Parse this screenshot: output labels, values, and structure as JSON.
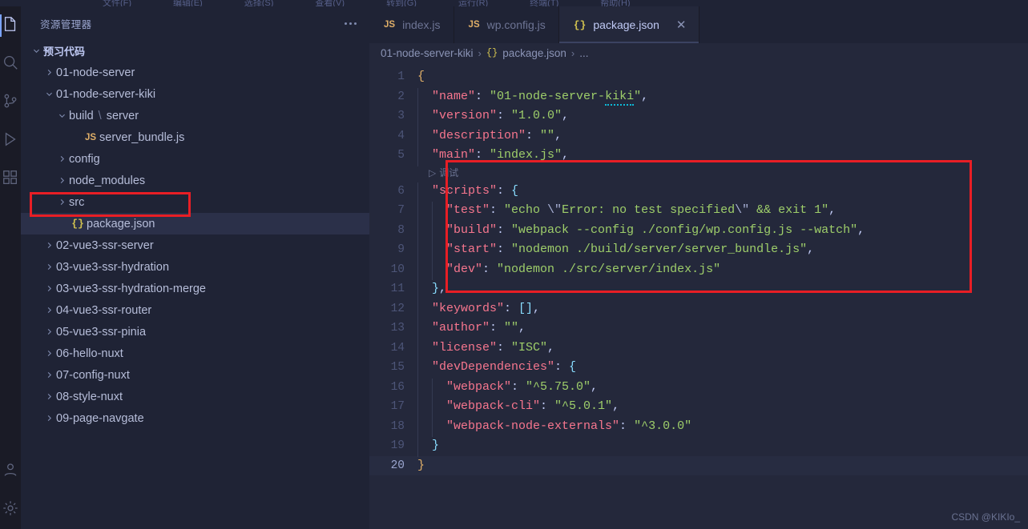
{
  "window": {
    "menu_items": [
      "文件(F)",
      "编辑(E)",
      "选择(S)",
      "查看(V)",
      "转到(G)",
      "运行(R)",
      "终端(T)",
      "帮助(H)"
    ]
  },
  "activitybar": {
    "items": [
      {
        "name": "explorer",
        "icon": "files-icon",
        "active": true
      },
      {
        "name": "search",
        "icon": "search-icon",
        "active": false
      },
      {
        "name": "source-control",
        "icon": "source-control-icon",
        "active": false
      },
      {
        "name": "run-and-debug",
        "icon": "run-debug-icon",
        "active": false
      },
      {
        "name": "extensions",
        "icon": "extensions-icon",
        "active": false
      },
      {
        "name": "accounts",
        "icon": "account-icon",
        "active": false
      },
      {
        "name": "settings",
        "icon": "gear-icon",
        "active": false
      }
    ]
  },
  "sidebar": {
    "title": "资源管理器",
    "more_actions": "more-actions",
    "tree": [
      {
        "label": "预习代码",
        "indent": 0,
        "type": "root",
        "expanded": true,
        "chevron": "down"
      },
      {
        "label": "01-node-server",
        "indent": 1,
        "type": "folder",
        "chevron": "right"
      },
      {
        "label": "01-node-server-kiki",
        "indent": 1,
        "type": "folder",
        "chevron": "down"
      },
      {
        "label": "build",
        "label2": "server",
        "indent": 2,
        "type": "folder",
        "chevron": "down"
      },
      {
        "label": "server_bundle.js",
        "indent": 3,
        "type": "file-js",
        "chevron": "none"
      },
      {
        "label": "config",
        "indent": 2,
        "type": "folder",
        "chevron": "right"
      },
      {
        "label": "node_modules",
        "indent": 2,
        "type": "folder",
        "chevron": "right"
      },
      {
        "label": "src",
        "indent": 2,
        "type": "folder",
        "chevron": "right"
      },
      {
        "label": "package.json",
        "indent": 2,
        "type": "file-json",
        "chevron": "none",
        "selected": true,
        "highlighted": true
      },
      {
        "label": "02-vue3-ssr-server",
        "indent": 1,
        "type": "folder",
        "chevron": "right"
      },
      {
        "label": "03-vue3-ssr-hydration",
        "indent": 1,
        "type": "folder",
        "chevron": "right"
      },
      {
        "label": "03-vue3-ssr-hydration-merge",
        "indent": 1,
        "type": "folder",
        "chevron": "right"
      },
      {
        "label": "04-vue3-ssr-router",
        "indent": 1,
        "type": "folder",
        "chevron": "right"
      },
      {
        "label": "05-vue3-ssr-pinia",
        "indent": 1,
        "type": "folder",
        "chevron": "right"
      },
      {
        "label": "06-hello-nuxt",
        "indent": 1,
        "type": "folder",
        "chevron": "right"
      },
      {
        "label": "07-config-nuxt",
        "indent": 1,
        "type": "folder",
        "chevron": "right"
      },
      {
        "label": "08-style-nuxt",
        "indent": 1,
        "type": "folder",
        "chevron": "right"
      },
      {
        "label": "09-page-navgate",
        "indent": 1,
        "type": "folder",
        "chevron": "right"
      }
    ]
  },
  "editor": {
    "tabs": [
      {
        "label": "index.js",
        "icon": "js",
        "icon_text": "JS",
        "active": false,
        "closable": false
      },
      {
        "label": "wp.config.js",
        "icon": "js",
        "icon_text": "JS",
        "active": false,
        "closable": false
      },
      {
        "label": "package.json",
        "icon": "json",
        "icon_text": "{}",
        "active": true,
        "closable": true,
        "close_label": "✕"
      }
    ],
    "breadcrumb": [
      {
        "text": "01-node-server-kiki",
        "icon": null
      },
      {
        "text": "package.json",
        "icon": "{}"
      },
      {
        "text": "...",
        "icon": null
      }
    ],
    "breadcrumb_separator": "›",
    "codelens": {
      "label": "调试",
      "icon": "▷",
      "line_before": 6
    },
    "current_line": 20,
    "lines": [
      {
        "n": 1,
        "tokens": [
          {
            "t": "{",
            "c": "b1"
          }
        ]
      },
      {
        "n": 2,
        "indent": 1,
        "tokens": [
          {
            "t": "\"name\"",
            "c": "k"
          },
          {
            "t": ": ",
            "c": "b2"
          },
          {
            "t": "\"01-node-server-",
            "c": "s"
          },
          {
            "t": "kiki",
            "c": "s squig"
          },
          {
            "t": "\"",
            "c": "s"
          },
          {
            "t": ",",
            "c": "b2"
          }
        ]
      },
      {
        "n": 3,
        "indent": 1,
        "tokens": [
          {
            "t": "\"version\"",
            "c": "k"
          },
          {
            "t": ": ",
            "c": "b2"
          },
          {
            "t": "\"1.0.0\"",
            "c": "s"
          },
          {
            "t": ",",
            "c": "b2"
          }
        ]
      },
      {
        "n": 4,
        "indent": 1,
        "tokens": [
          {
            "t": "\"description\"",
            "c": "k"
          },
          {
            "t": ": ",
            "c": "b2"
          },
          {
            "t": "\"\"",
            "c": "s"
          },
          {
            "t": ",",
            "c": "b2"
          }
        ]
      },
      {
        "n": 5,
        "indent": 1,
        "tokens": [
          {
            "t": "\"main\"",
            "c": "k"
          },
          {
            "t": ": ",
            "c": "b2"
          },
          {
            "t": "\"index.js\"",
            "c": "s"
          },
          {
            "t": ",",
            "c": "b2"
          }
        ]
      },
      {
        "n": 6,
        "indent": 1,
        "tokens": [
          {
            "t": "\"scripts\"",
            "c": "k"
          },
          {
            "t": ": ",
            "c": "b2"
          },
          {
            "t": "{",
            "c": "p"
          }
        ]
      },
      {
        "n": 7,
        "indent": 2,
        "tokens": [
          {
            "t": "\"test\"",
            "c": "k"
          },
          {
            "t": ": ",
            "c": "b2"
          },
          {
            "t": "\"echo ",
            "c": "s"
          },
          {
            "t": "\\\"",
            "c": "esc"
          },
          {
            "t": "Error: no test specified",
            "c": "s"
          },
          {
            "t": "\\\"",
            "c": "esc"
          },
          {
            "t": " && exit 1\"",
            "c": "s"
          },
          {
            "t": ",",
            "c": "b2"
          }
        ]
      },
      {
        "n": 8,
        "indent": 2,
        "tokens": [
          {
            "t": "\"build\"",
            "c": "k"
          },
          {
            "t": ": ",
            "c": "b2"
          },
          {
            "t": "\"webpack --config ./config/wp.config.js --watch\"",
            "c": "s"
          },
          {
            "t": ",",
            "c": "b2"
          }
        ]
      },
      {
        "n": 9,
        "indent": 2,
        "tokens": [
          {
            "t": "\"start\"",
            "c": "k"
          },
          {
            "t": ": ",
            "c": "b2"
          },
          {
            "t": "\"nodemon ./build/server/server_bundle.js\"",
            "c": "s"
          },
          {
            "t": ",",
            "c": "b2"
          }
        ]
      },
      {
        "n": 10,
        "indent": 2,
        "tokens": [
          {
            "t": "\"dev\"",
            "c": "k"
          },
          {
            "t": ": ",
            "c": "b2"
          },
          {
            "t": "\"nodemon ./src/server/index.js\"",
            "c": "s"
          }
        ]
      },
      {
        "n": 11,
        "indent": 1,
        "tokens": [
          {
            "t": "}",
            "c": "p"
          },
          {
            "t": ",",
            "c": "b2"
          }
        ]
      },
      {
        "n": 12,
        "indent": 1,
        "tokens": [
          {
            "t": "\"keywords\"",
            "c": "k"
          },
          {
            "t": ": ",
            "c": "b2"
          },
          {
            "t": "[]",
            "c": "p"
          },
          {
            "t": ",",
            "c": "b2"
          }
        ]
      },
      {
        "n": 13,
        "indent": 1,
        "tokens": [
          {
            "t": "\"author\"",
            "c": "k"
          },
          {
            "t": ": ",
            "c": "b2"
          },
          {
            "t": "\"\"",
            "c": "s"
          },
          {
            "t": ",",
            "c": "b2"
          }
        ]
      },
      {
        "n": 14,
        "indent": 1,
        "tokens": [
          {
            "t": "\"license\"",
            "c": "k"
          },
          {
            "t": ": ",
            "c": "b2"
          },
          {
            "t": "\"ISC\"",
            "c": "s"
          },
          {
            "t": ",",
            "c": "b2"
          }
        ]
      },
      {
        "n": 15,
        "indent": 1,
        "tokens": [
          {
            "t": "\"devDependencies\"",
            "c": "k"
          },
          {
            "t": ": ",
            "c": "b2"
          },
          {
            "t": "{",
            "c": "p"
          }
        ]
      },
      {
        "n": 16,
        "indent": 2,
        "tokens": [
          {
            "t": "\"webpack\"",
            "c": "k"
          },
          {
            "t": ": ",
            "c": "b2"
          },
          {
            "t": "\"^5.75.0\"",
            "c": "s"
          },
          {
            "t": ",",
            "c": "b2"
          }
        ]
      },
      {
        "n": 17,
        "indent": 2,
        "tokens": [
          {
            "t": "\"webpack-cli\"",
            "c": "k"
          },
          {
            "t": ": ",
            "c": "b2"
          },
          {
            "t": "\"^5.0.1\"",
            "c": "s"
          },
          {
            "t": ",",
            "c": "b2"
          }
        ]
      },
      {
        "n": 18,
        "indent": 2,
        "tokens": [
          {
            "t": "\"webpack-node-externals\"",
            "c": "k"
          },
          {
            "t": ": ",
            "c": "b2"
          },
          {
            "t": "\"^3.0.0\"",
            "c": "s"
          }
        ]
      },
      {
        "n": 19,
        "indent": 1,
        "tokens": [
          {
            "t": "}",
            "c": "p"
          }
        ]
      },
      {
        "n": 20,
        "tokens": [
          {
            "t": "}",
            "c": "b1"
          }
        ]
      }
    ]
  },
  "annotations": {
    "color": "#e81e25",
    "boxes": [
      {
        "name": "package-json-tree-highlight",
        "target": "sidebar"
      },
      {
        "name": "scripts-block-highlight",
        "target": "editor"
      }
    ]
  },
  "watermark": "CSDN @KIKIo_"
}
